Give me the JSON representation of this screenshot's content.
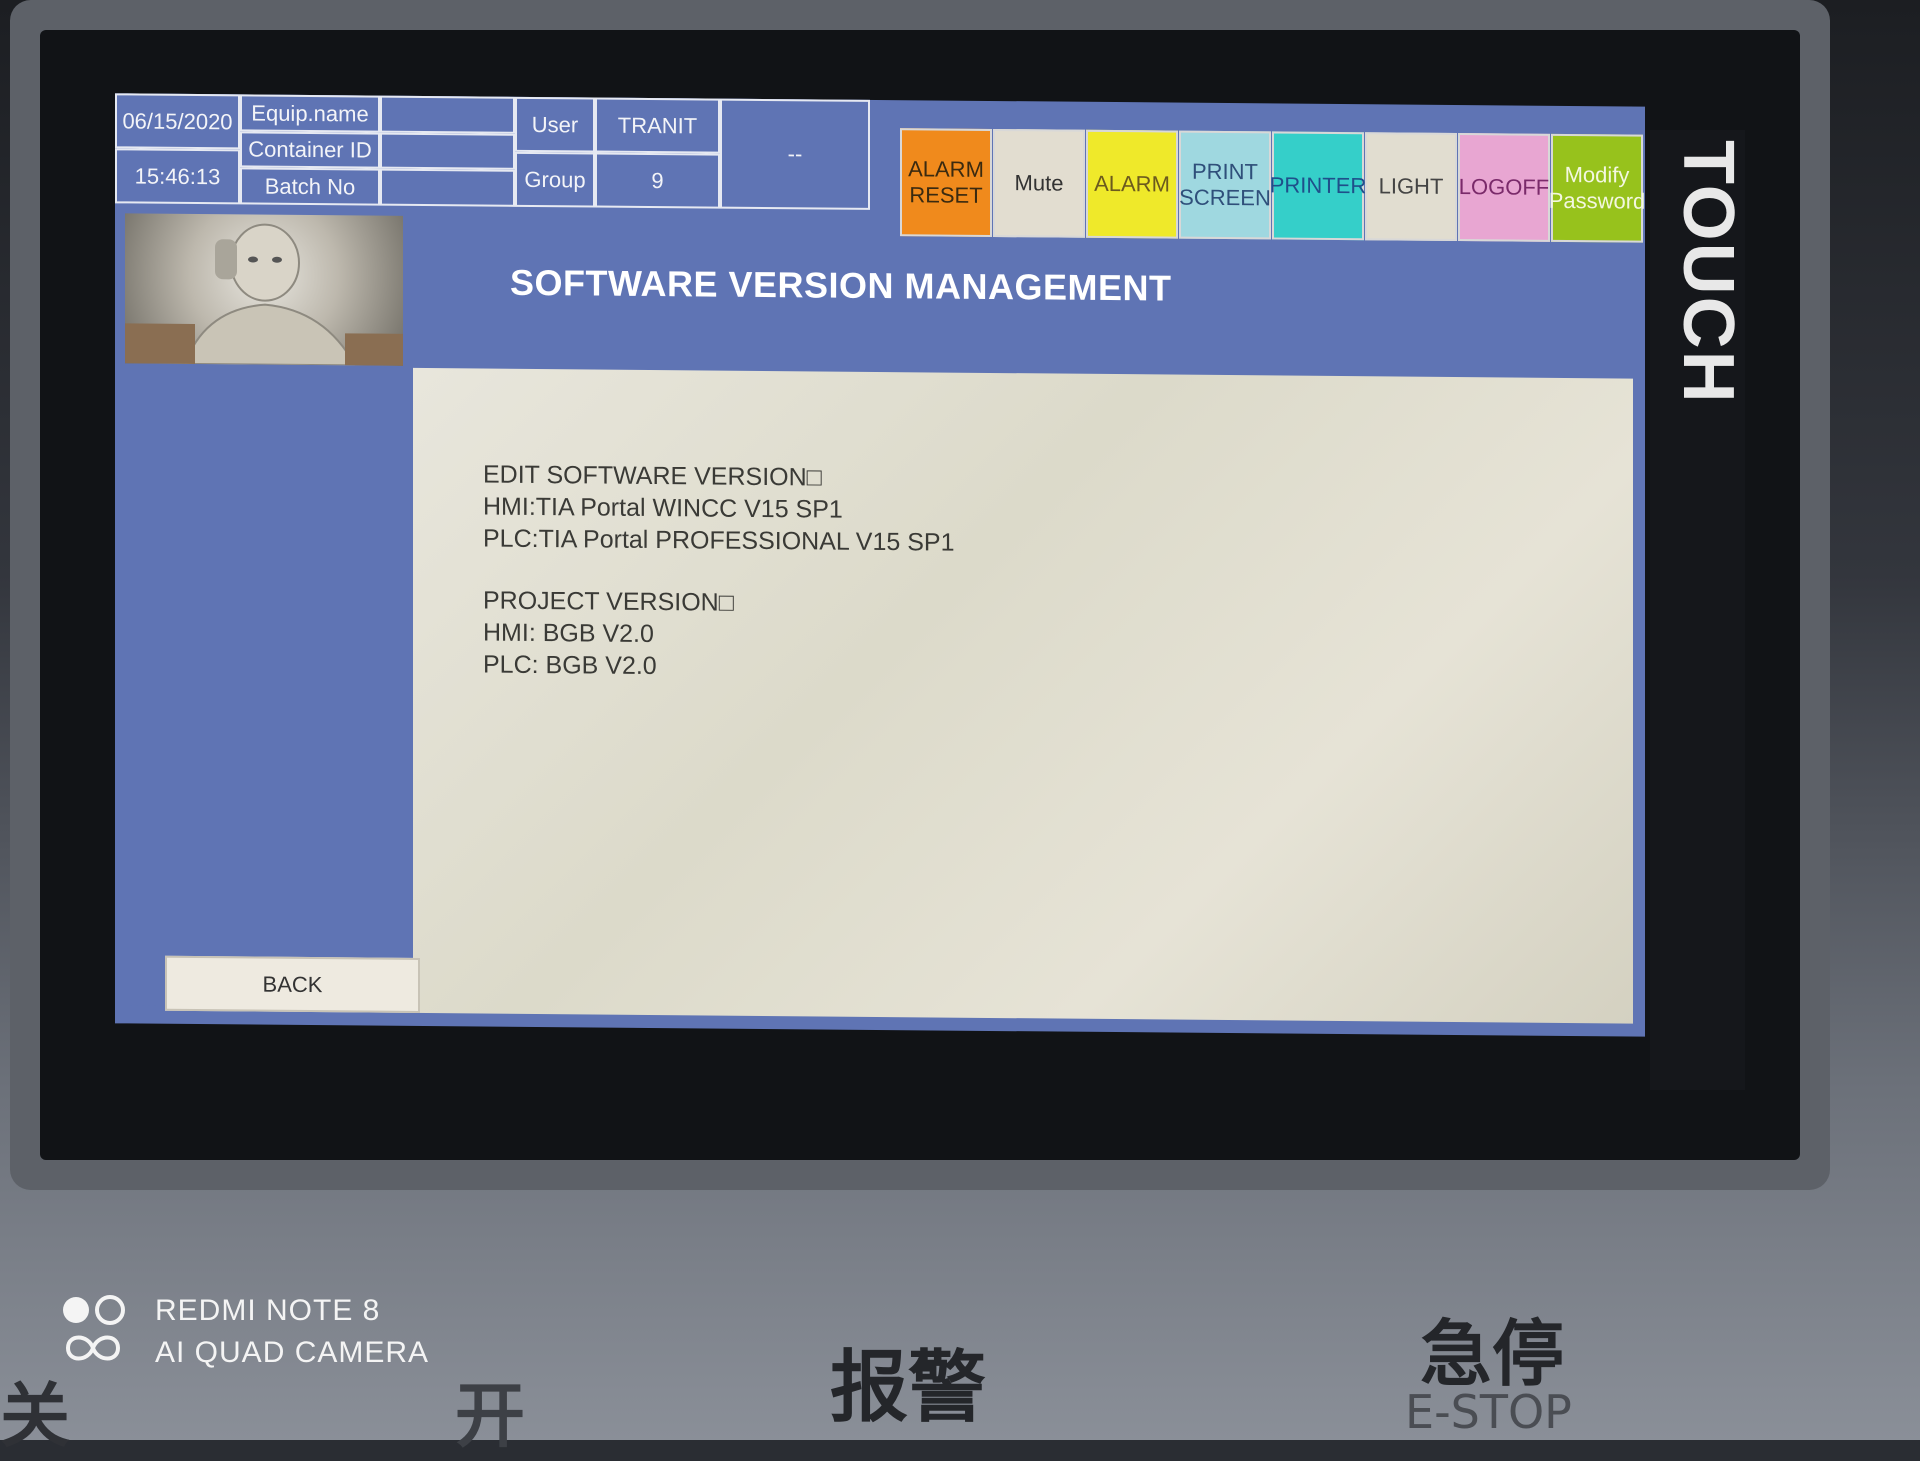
{
  "header": {
    "date": "06/15/2020",
    "time": "15:46:13",
    "fields": [
      "Equip.name",
      "Container ID",
      "Batch No"
    ],
    "user_label": "User",
    "user_value": "TRANIT",
    "group_label": "Group",
    "group_value": "9",
    "status_value": "--"
  },
  "toolbar": {
    "buttons": [
      {
        "label": "ALARM\nRESET",
        "color": "#f08a1c",
        "text_color": "#3a2a10"
      },
      {
        "label": "Mute",
        "color": "#e2ddd0",
        "text_color": "#333333"
      },
      {
        "label": "ALARM",
        "color": "#efe92a",
        "text_color": "#6b5a1e"
      },
      {
        "label": "PRINT\nSCREEN",
        "color": "#9fd8e0",
        "text_color": "#2f4f7a"
      },
      {
        "label": "PRINTER",
        "color": "#35cfc9",
        "text_color": "#1f4f8a"
      },
      {
        "label": "LIGHT",
        "color": "#e1ddd0",
        "text_color": "#444444"
      },
      {
        "label": "LOGOFF",
        "color": "#e8a6d2",
        "text_color": "#7a2a6a"
      },
      {
        "label": "Modify\nPassword",
        "color": "#97c21c",
        "text_color": "#f3f7e0"
      }
    ]
  },
  "page": {
    "title": "SOFTWARE VERSION MANAGEMENT",
    "back_label": "BACK"
  },
  "content": {
    "lines_a": [
      "EDIT SOFTWARE VERSION□",
      "HMI:TIA Portal WINCC V15 SP1",
      "PLC:TIA Portal PROFESSIONAL V15 SP1"
    ],
    "lines_b": [
      "PROJECT VERSION□",
      "HMI: BGB V2.0",
      "PLC: BGB V2.0"
    ]
  },
  "device": {
    "side_label": "TOUCH",
    "watermark_line1": "REDMI NOTE 8",
    "watermark_line2": "AI QUAD CAMERA",
    "panel_labels": [
      "关",
      "开",
      "报警",
      "急停",
      "E-STOP"
    ]
  }
}
